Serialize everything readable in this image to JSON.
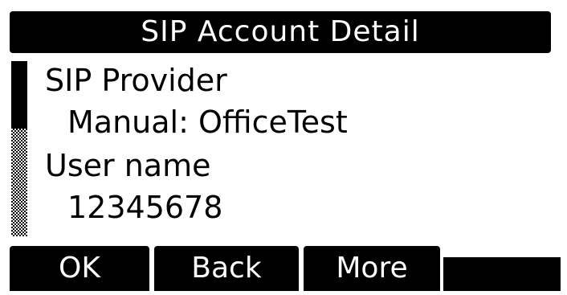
{
  "header": {
    "title": "SIP Account Detail"
  },
  "fields": [
    {
      "label": "SIP Provider",
      "value": "Manual: OfficeTest"
    },
    {
      "label": "User name",
      "value": "12345678"
    }
  ],
  "softkeys": {
    "ok": "OK",
    "back": "Back",
    "more": "More"
  },
  "colors": {
    "background": "#ffffff",
    "foreground": "#000000"
  }
}
